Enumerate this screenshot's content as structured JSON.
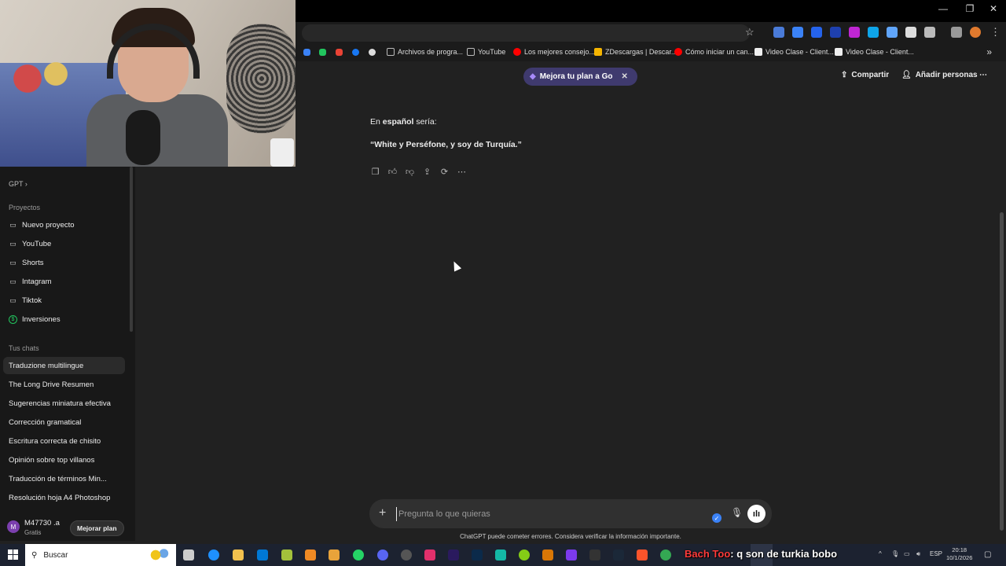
{
  "browser": {
    "bookmarks": [
      {
        "label": "Archivos de progra...",
        "icon": "folder-icon",
        "color": "#bbbbbb"
      },
      {
        "label": "YouTube",
        "icon": "folder-icon",
        "color": "#bbbbbb"
      },
      {
        "label": "Los mejores consejo...",
        "icon": "youtube-icon",
        "color": "#ff0000"
      },
      {
        "label": "ZDescargas | Descar...",
        "icon": "z-icon",
        "color": "#f5b400"
      },
      {
        "label": "Cómo iniciar un can...",
        "icon": "youtube-icon",
        "color": "#ff0000"
      },
      {
        "label": "Video Clase - Client...",
        "icon": "cc-icon",
        "color": "#eeeeee"
      },
      {
        "label": "Video Clase - Client...",
        "icon": "cc-icon",
        "color": "#eeeeee"
      }
    ]
  },
  "header": {
    "upgrade_pill": "Mejora tu plan a Go",
    "share": "Compartir",
    "add_people": "Añadir personas"
  },
  "sidebar": {
    "gpt_label": "GPT",
    "projects_title": "Proyectos",
    "projects": [
      {
        "label": "Nuevo proyecto",
        "icon": "new-folder-icon"
      },
      {
        "label": "YouTube",
        "icon": "folder-icon"
      },
      {
        "label": "Shorts",
        "icon": "folder-icon"
      },
      {
        "label": "Intagram",
        "icon": "folder-icon"
      },
      {
        "label": "Tiktok",
        "icon": "folder-icon"
      },
      {
        "label": "Inversiones",
        "icon": "dollar-icon"
      }
    ],
    "chats_title": "Tus chats",
    "chats": [
      "Traduzione multilingue",
      "The Long Drive Resumen",
      "Sugerencias miniatura efectiva",
      "Corrección gramatical",
      "Escritura correcta de chisito",
      "Opinión sobre top villanos",
      "Traducción de términos Min...",
      "Resolución hoja A4 Photoshop"
    ],
    "user": {
      "initial": "M",
      "name": "M47730 .a",
      "plan": "Gratis",
      "upgrade": "Mejorar plan"
    }
  },
  "conversation": {
    "line1_prefix": "En ",
    "line1_bold": "español",
    "line1_suffix": " sería:",
    "line2": "“White y Perséfone, y soy de Turquía.”"
  },
  "composer": {
    "placeholder": "Pregunta lo que quieras",
    "disclaimer": "ChatGPT puede cometer errores. Considera verificar la información importante."
  },
  "taskbar": {
    "search": "Buscar",
    "overlay_prefix": "Bach Too",
    "overlay_text": ": q son de turkia bobo",
    "lang": "ESP",
    "time": "20:18",
    "date": "10/1/2026"
  }
}
